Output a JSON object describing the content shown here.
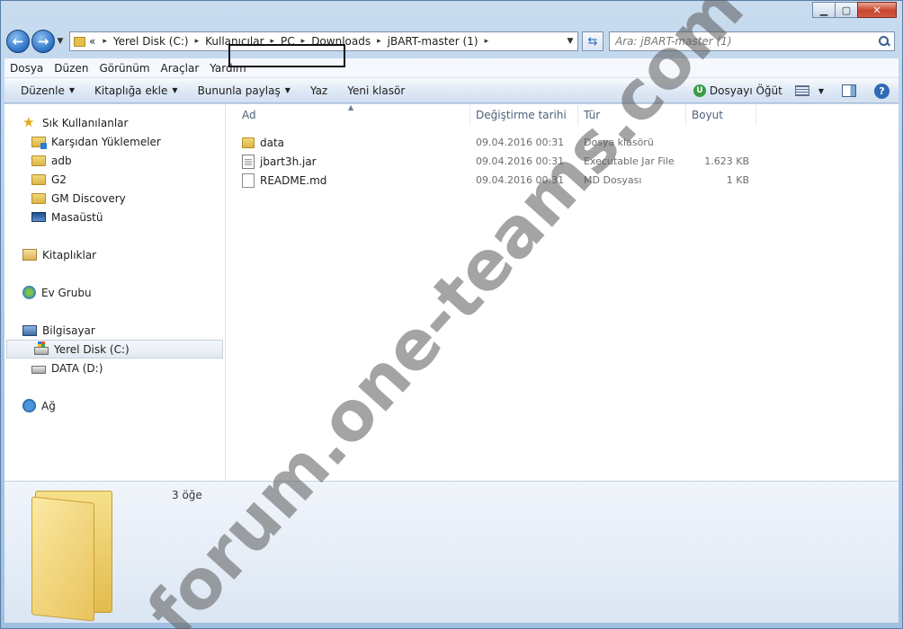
{
  "address": {
    "overflow": "«",
    "crumbs": [
      "Yerel Disk (C:)",
      "Kullanıcılar",
      "PC",
      "Downloads",
      "jBART-master (1)"
    ]
  },
  "search": {
    "placeholder": "Ara: jBART-master (1)"
  },
  "menu": [
    "Dosya",
    "Düzen",
    "Görünüm",
    "Araçlar",
    "Yardım"
  ],
  "commands": {
    "organize": "Düzenle",
    "include_library": "Kitaplığa ekle",
    "share_with": "Bununla paylaş",
    "print": "Yaz",
    "new_folder": "Yeni klasör",
    "open": "Dosyayı Öğüt"
  },
  "sidebar": {
    "favorites": "Sık Kullanılanlar",
    "favorite_items": [
      "Karşıdan Yüklemeler",
      "adb",
      "G2",
      "GM Discovery",
      "Masaüstü"
    ],
    "libraries": "Kitaplıklar",
    "homegroup": "Ev Grubu",
    "computer": "Bilgisayar",
    "drives": [
      "Yerel Disk (C:)",
      "DATA (D:)"
    ],
    "network": "Ağ"
  },
  "columns": {
    "name": "Ad",
    "date": "Değiştirme tarihi",
    "type": "Tür",
    "size": "Boyut"
  },
  "files": [
    {
      "name": "data",
      "date": "09.04.2016 00:31",
      "type": "Dosya klasörü",
      "size": "",
      "icon": "folder-icon"
    },
    {
      "name": "jbart3h.jar",
      "date": "09.04.2016 00:31",
      "type": "Executable Jar File",
      "size": "1.623 KB",
      "icon": "jar-file-icon"
    },
    {
      "name": "README.md",
      "date": "09.04.2016 00:31",
      "type": "MD Dosyası",
      "size": "1 KB",
      "icon": "document-icon"
    }
  ],
  "details": {
    "item_count": "3 öğe"
  },
  "watermark": "forum.one-teams.com"
}
